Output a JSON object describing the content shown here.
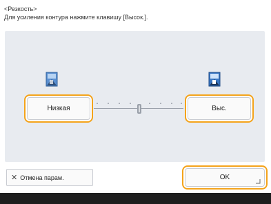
{
  "header": {
    "title": "<Резкость>",
    "instruction": "Для усиления контура нажмите клавишу [Высок.]."
  },
  "panel": {
    "low_icon": "image-low-sharpness-icon",
    "high_icon": "image-high-sharpness-icon",
    "low_label": "Низкая",
    "high_label": "Выс.",
    "slider_level_fraction": 0.5
  },
  "footer": {
    "cancel_label": "Отмена парам.",
    "ok_label": "OK"
  },
  "colors": {
    "accent": "#f4a31a",
    "panel_bg": "#e8ebf0",
    "bottom_bar": "#1e1e1e"
  }
}
